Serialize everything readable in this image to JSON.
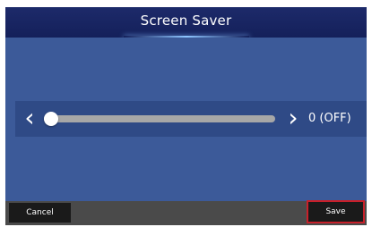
{
  "header": {
    "title": "Screen Saver"
  },
  "slider": {
    "value_label": "0 (OFF)",
    "level": 0
  },
  "footer": {
    "cancel_label": "Cancel",
    "save_label": "Save"
  },
  "colors": {
    "header_bg": "#1d2a6a",
    "content_bg": "#3c5a99",
    "slider_panel_bg": "#2f4a86",
    "track": "#a7a7a7",
    "footer_bg": "#4a4a4a",
    "button_bg": "#1a1a1a",
    "highlight": "#c8202a"
  },
  "icons": {
    "decrease": "chevron-left-icon",
    "increase": "chevron-right-icon"
  }
}
